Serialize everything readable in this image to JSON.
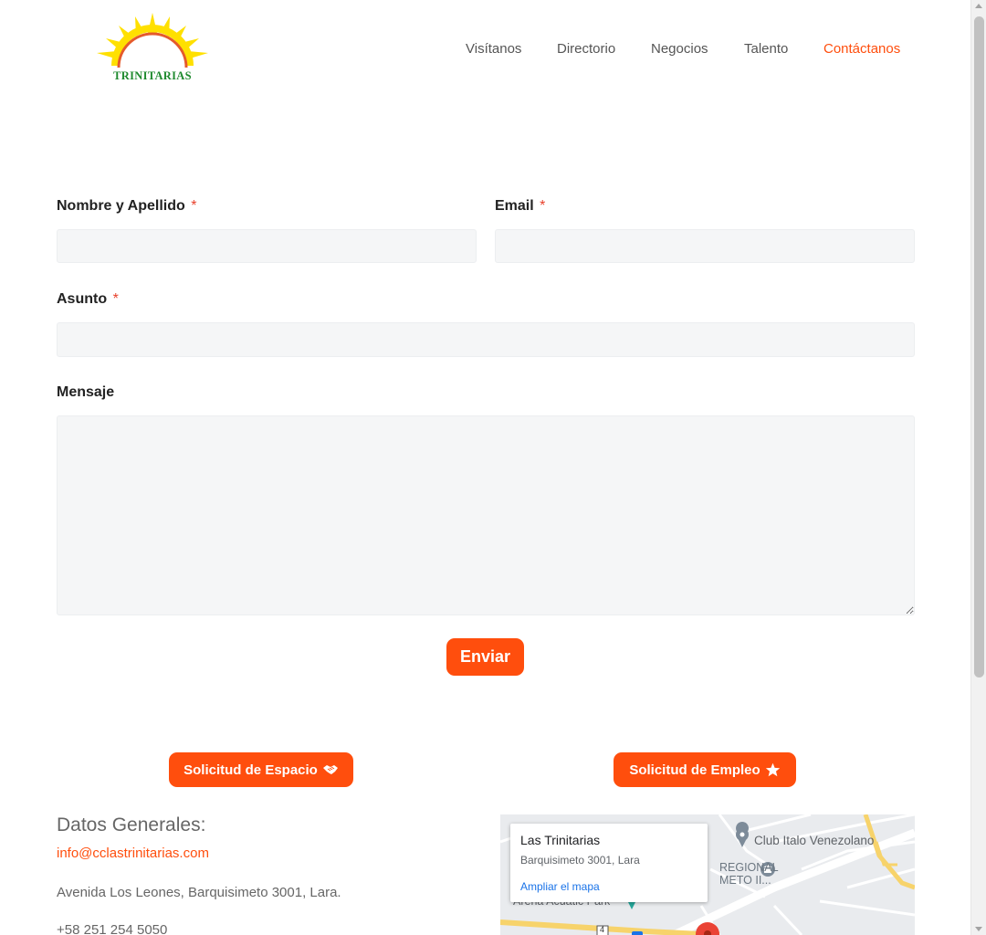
{
  "header": {
    "logo_text": "TRINITARIAS",
    "nav": [
      {
        "label": "Visítanos"
      },
      {
        "label": "Directorio"
      },
      {
        "label": "Negocios"
      },
      {
        "label": "Talento"
      },
      {
        "label": "Contáctanos",
        "active": true
      }
    ]
  },
  "form": {
    "name": {
      "label": "Nombre y Apellido",
      "required_mark": "*",
      "value": ""
    },
    "email": {
      "label": "Email",
      "required_mark": "*",
      "value": ""
    },
    "subject": {
      "label": "Asunto",
      "required_mark": "*",
      "value": ""
    },
    "message": {
      "label": "Mensaje",
      "value": ""
    },
    "submit_label": "Enviar"
  },
  "actions": {
    "espacio_label": "Solicitud de Espacio",
    "espacio_icon": "handshake-icon",
    "empleo_label": "Solicitud de Empleo",
    "empleo_icon": "star-icon"
  },
  "info": {
    "title": "Datos Generales:",
    "email": "info@cclastrinitarias.com",
    "address": "Avenida Los Leones, Barquisimeto 3001, Lara.",
    "phone": "+58 251 254 5050"
  },
  "map": {
    "place_name": "Las Trinitarias",
    "place_address": "Barquisimeto 3001, Lara",
    "expand_link": "Ampliar el mapa",
    "poi_club": "Club Italo Venezolano",
    "poi_regional_1": "REGIONAL",
    "poi_regional_2": "METO II...",
    "poi_arena": "Arena Acuatic Park",
    "road_number": "4"
  },
  "colors": {
    "accent": "#ff4e0d",
    "required": "#e8412c",
    "field_bg": "#f5f6f7",
    "logo_green": "#1e8a2e",
    "logo_yellow": "#ffe000"
  }
}
